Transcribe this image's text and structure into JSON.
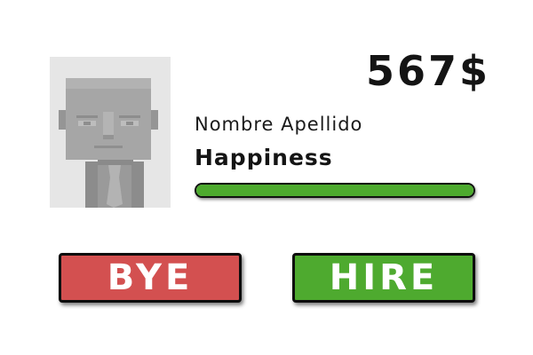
{
  "header": {
    "money": "567$"
  },
  "candidate": {
    "name": "Nombre Apellido",
    "stat_label": "Happiness",
    "happiness_fraction": 1.0
  },
  "colors": {
    "bye_button": "#d35050",
    "hire_button": "#4eaa2f",
    "bar_fill": "#4daa2e",
    "avatar_background": "#e6e6e6"
  },
  "actions": {
    "bye_label": "BYE",
    "hire_label": "HIRE"
  },
  "icons": {
    "avatar": "blocky-character-portrait"
  }
}
